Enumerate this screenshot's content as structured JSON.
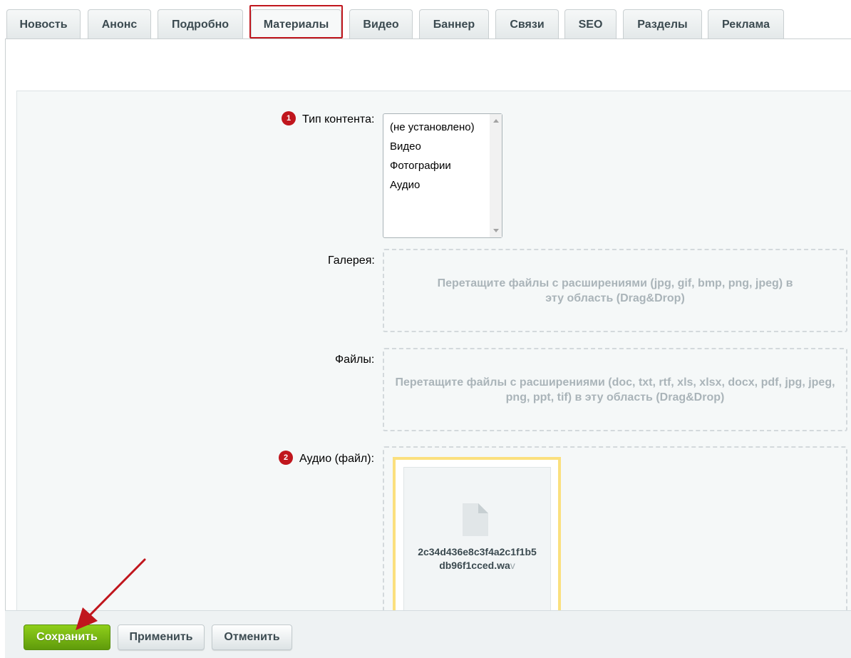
{
  "tabs": [
    {
      "label": "Новость"
    },
    {
      "label": "Анонс"
    },
    {
      "label": "Подробно"
    },
    {
      "label": "Материалы",
      "active": true
    },
    {
      "label": "Видео"
    },
    {
      "label": "Баннер"
    },
    {
      "label": "Связи"
    },
    {
      "label": "SEO"
    },
    {
      "label": "Разделы"
    },
    {
      "label": "Реклама"
    }
  ],
  "form": {
    "content_type": {
      "badge": "1",
      "label": "Тип контента:",
      "options": [
        "(не установлено)",
        "Видео",
        "Фотографии",
        "Аудио"
      ]
    },
    "gallery": {
      "label": "Галерея:",
      "dropzone_text": "Перетащите файлы с расширениями (jpg, gif, bmp, png, jpeg) в эту область (Drag&Drop)"
    },
    "files": {
      "label": "Файлы:",
      "dropzone_text": "Перетащите файлы с расширениями (doc, txt, rtf, xls, xlsx, docx, pdf, jpg, jpeg, png, ppt, tif) в эту область (Drag&Drop)"
    },
    "audio": {
      "badge": "2",
      "label": "Аудио (файл):",
      "file": {
        "name_line1": "2c34d436e8c3f4a2c1f1b5",
        "name_line2": "db96f1cced.wa",
        "name_ext": "v",
        "icon": "file-icon"
      }
    }
  },
  "footer": {
    "save_label": "Сохранить",
    "apply_label": "Применить",
    "cancel_label": "Отменить"
  },
  "colors": {
    "accent_red": "#c0161d",
    "save_green": "#6aab10",
    "highlight_yellow": "#fbe07e"
  }
}
